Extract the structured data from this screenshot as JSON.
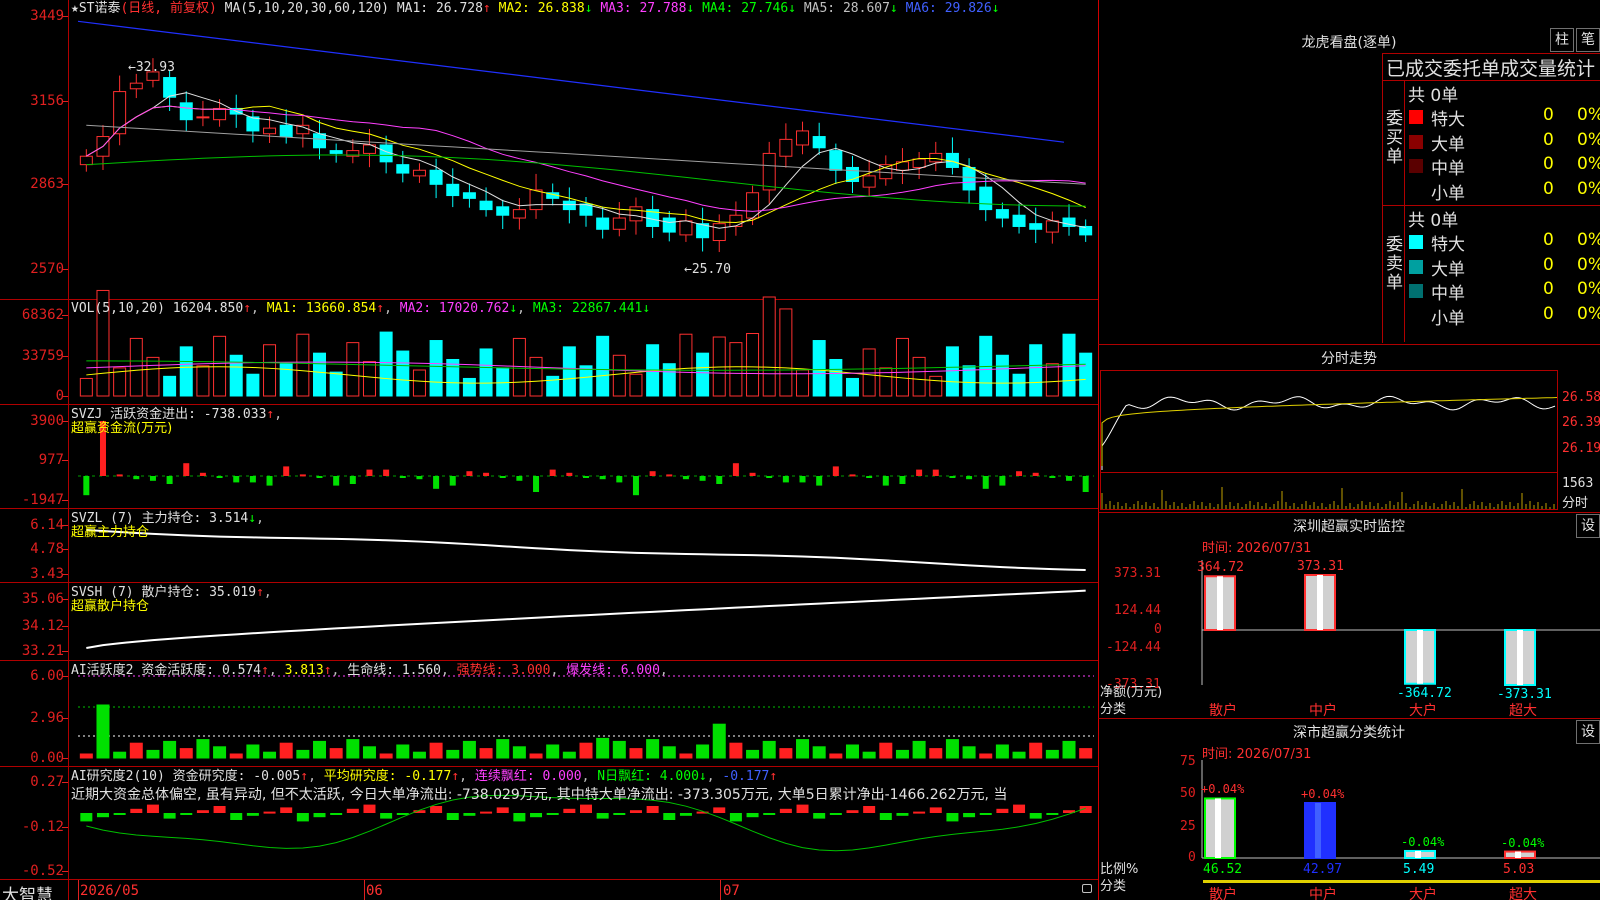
{
  "stock": {
    "name": "★ST诺泰",
    "period": "(日线, 前复权)",
    "ma_label": "MA(5,10,20,30,60,120)",
    "ma": [
      {
        "label": "MA1: 26.728",
        "arrow": "↑",
        "color": "#e0e0e0"
      },
      {
        "label": "MA2: 26.838",
        "arrow": "↓",
        "color": "#ffff00"
      },
      {
        "label": "MA3: 27.788",
        "arrow": "↓",
        "color": "#ff40ff"
      },
      {
        "label": "MA4: 27.746",
        "arrow": "↓",
        "color": "#00ff00"
      },
      {
        "label": "MA5: 28.607",
        "arrow": "↓",
        "color": "#c0c0c0"
      },
      {
        "label": "MA6: 29.826",
        "arrow": "↓",
        "color": "#4060ff"
      }
    ],
    "price_axis": [
      "3449",
      "3156",
      "2863",
      "2570"
    ],
    "high_label": "32.93",
    "low_label": "25.70"
  },
  "volume": {
    "title": "VOL(5,10,20)",
    "value": "16204.850",
    "ma1": "MA1: 13660.854",
    "ma2": "MA2: 17020.762",
    "ma3": "MA3: 22867.441",
    "axis": [
      "68362",
      "33759",
      "0"
    ]
  },
  "svzj": {
    "title": "SVZJ  活跃资金进出: -738.033",
    "subtitle": "超赢资金流(万元)",
    "axis": [
      "3900",
      "977",
      "-1947"
    ]
  },
  "svzl": {
    "title": "SVZL (7) 主力持仓: 3.514",
    "subtitle": "超赢主力持仓",
    "axis": [
      "6.14",
      "4.78",
      "3.43"
    ]
  },
  "svsh": {
    "title": "SVSH (7) 散户持仓: 35.019",
    "subtitle": "超赢散户持仓",
    "axis": [
      "35.06",
      "34.12",
      "33.21"
    ]
  },
  "ai_active": {
    "title": "AI活跃度2 资金活跃度: 0.574",
    "v2": "3.813",
    "life": "生命线: 1.560",
    "strong": "强势线: 3.000",
    "burst": "爆发线: 6.000",
    "axis": [
      "6.00",
      "2.96",
      "0.00"
    ]
  },
  "ai_research": {
    "title": "AI研究度2(10) 资金研究度: -0.005",
    "avg": "平均研究度: -0.177",
    "cont": "连续飘红: 0.000",
    "nday": "N日飘红: 4.000",
    "last": "-0.177",
    "comment": "近期大资金总体偏空, 虽有异动, 但不太活跃, 今日大单净流出: -738.029万元, 其中特大单净流出: -373.305万元, 大单5日累计净出-1466.262万元, 当",
    "axis": [
      "0.27",
      "-0.12",
      "-0.52"
    ]
  },
  "time_axis": {
    "brand": "大智慧",
    "labels": [
      "2026/05",
      "06",
      "07"
    ]
  },
  "dragon": {
    "title": "龙虎看盘(逐单)",
    "btn1": "柱",
    "btn2": "笔",
    "header": "已成交委托单成交量统计",
    "buy_label": "委买单",
    "sell_label": "委卖单",
    "buy_total": "共 0单",
    "sell_total": "共 0单",
    "buy_rows": [
      {
        "name": "特大",
        "count": "0",
        "pct": "0%",
        "color": "#ff0000"
      },
      {
        "name": "大单",
        "count": "0",
        "pct": "0%",
        "color": "#8a0000"
      },
      {
        "name": "中单",
        "count": "0",
        "pct": "0%",
        "color": "#5a0000"
      },
      {
        "name": "小单",
        "count": "0",
        "pct": "0%",
        "color": "#000000"
      }
    ],
    "sell_rows": [
      {
        "name": "特大",
        "count": "0",
        "pct": "0%",
        "color": "#00ffff"
      },
      {
        "name": "大单",
        "count": "0",
        "pct": "0%",
        "color": "#00a0a0"
      },
      {
        "name": "中单",
        "count": "0",
        "pct": "0%",
        "color": "#007070"
      },
      {
        "name": "小单",
        "count": "0",
        "pct": "0%",
        "color": "#000000"
      }
    ]
  },
  "intraday": {
    "title": "分时走势",
    "axis": [
      "26.58",
      "26.39",
      "26.19"
    ],
    "vol_label": "1563",
    "vol_unit": "分时"
  },
  "sz_monitor": {
    "title": "深圳超赢实时监控",
    "btn": "设",
    "time": "时间: 2026/07/31",
    "axis": [
      "373.31",
      "124.44",
      "0",
      "-124.44",
      "-373.31"
    ],
    "y_label": "净额(万元)",
    "x_label": "分类",
    "categories": [
      "散户",
      "中户",
      "大户",
      "超大"
    ],
    "values": [
      364.72,
      373.31,
      -364.72,
      -373.31
    ],
    "value_labels": [
      "364.72",
      "373.31",
      "-364.72",
      "-373.31"
    ]
  },
  "sz_class": {
    "title": "深市超赢分类统计",
    "btn": "设",
    "time": "时间: 2026/07/31",
    "axis": [
      "75",
      "50",
      "25",
      "0"
    ],
    "y_label": "比例%",
    "x_label": "分类",
    "categories": [
      "散户",
      "中户",
      "大户",
      "超大"
    ],
    "values": [
      46.52,
      42.97,
      5.49,
      5.03
    ],
    "value_labels": [
      "46.52",
      "42.97",
      "5.49",
      "5.03"
    ],
    "changes": [
      "+0.04%",
      "+0.04%",
      "-0.04%",
      "-0.04%"
    ]
  }
}
